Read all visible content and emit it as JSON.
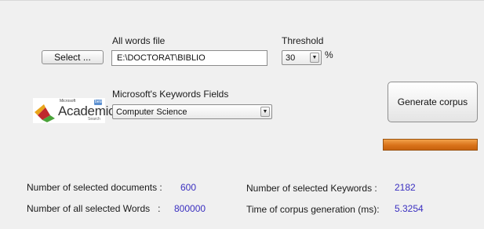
{
  "file": {
    "label": "All words file",
    "select_button": "Select ...",
    "path_value": "E:\\DOCTORAT\\BIBLIO"
  },
  "threshold": {
    "label": "Threshold",
    "value": "30",
    "unit": "%"
  },
  "keywords": {
    "label": "Microsoft's Keywords Fields",
    "selected": "Computer Science"
  },
  "logo": {
    "brand": "Microsoft",
    "name": "Academic",
    "sub": "Search",
    "badge": "beta"
  },
  "generate_button": "Generate corpus",
  "progress": {
    "fraction": 1.0,
    "color": "#e07b1f"
  },
  "stats": {
    "selected_documents": {
      "label": "Number of selected documents :",
      "value": "600"
    },
    "all_selected_words": {
      "label": "Number of all selected Words   :",
      "value": "800000"
    },
    "selected_keywords": {
      "label": "Number of selected Keywords :",
      "value": "2182"
    },
    "generation_time": {
      "label": "Time of corpus generation (ms):",
      "value": "5.3254"
    }
  },
  "colors": {
    "value_text": "#3a2fc0",
    "window_bg": "#f0f0f0"
  },
  "icons": {
    "dropdown_arrow": "▼"
  }
}
